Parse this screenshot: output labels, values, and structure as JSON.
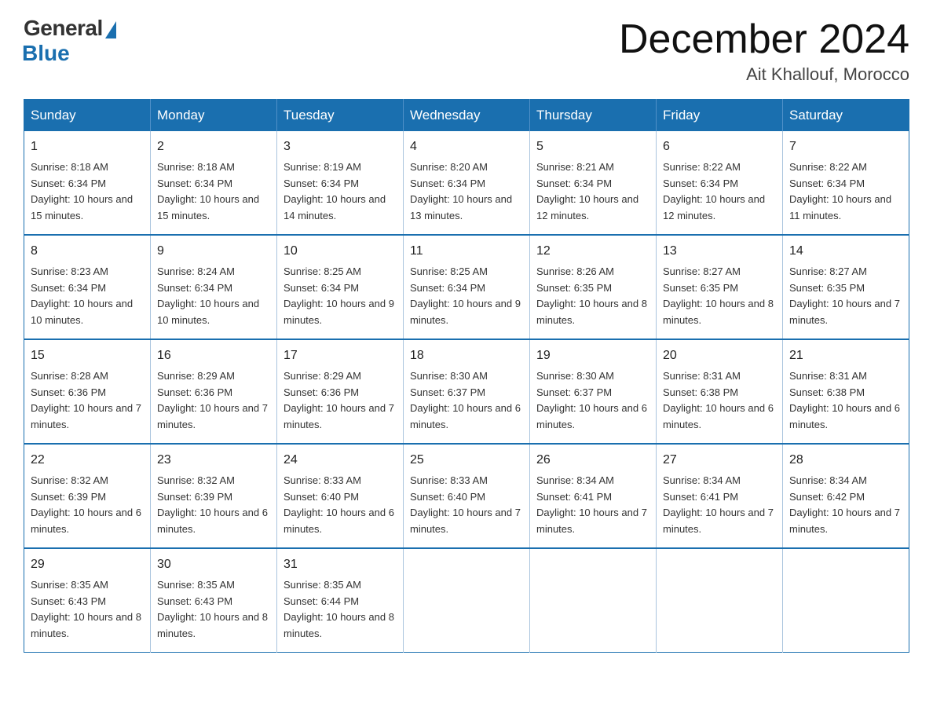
{
  "header": {
    "logo_general": "General",
    "logo_blue": "Blue",
    "title": "December 2024",
    "subtitle": "Ait Khallouf, Morocco"
  },
  "weekdays": [
    "Sunday",
    "Monday",
    "Tuesday",
    "Wednesday",
    "Thursday",
    "Friday",
    "Saturday"
  ],
  "weeks": [
    [
      {
        "day": "1",
        "sunrise": "8:18 AM",
        "sunset": "6:34 PM",
        "daylight": "10 hours and 15 minutes."
      },
      {
        "day": "2",
        "sunrise": "8:18 AM",
        "sunset": "6:34 PM",
        "daylight": "10 hours and 15 minutes."
      },
      {
        "day": "3",
        "sunrise": "8:19 AM",
        "sunset": "6:34 PM",
        "daylight": "10 hours and 14 minutes."
      },
      {
        "day": "4",
        "sunrise": "8:20 AM",
        "sunset": "6:34 PM",
        "daylight": "10 hours and 13 minutes."
      },
      {
        "day": "5",
        "sunrise": "8:21 AM",
        "sunset": "6:34 PM",
        "daylight": "10 hours and 12 minutes."
      },
      {
        "day": "6",
        "sunrise": "8:22 AM",
        "sunset": "6:34 PM",
        "daylight": "10 hours and 12 minutes."
      },
      {
        "day": "7",
        "sunrise": "8:22 AM",
        "sunset": "6:34 PM",
        "daylight": "10 hours and 11 minutes."
      }
    ],
    [
      {
        "day": "8",
        "sunrise": "8:23 AM",
        "sunset": "6:34 PM",
        "daylight": "10 hours and 10 minutes."
      },
      {
        "day": "9",
        "sunrise": "8:24 AM",
        "sunset": "6:34 PM",
        "daylight": "10 hours and 10 minutes."
      },
      {
        "day": "10",
        "sunrise": "8:25 AM",
        "sunset": "6:34 PM",
        "daylight": "10 hours and 9 minutes."
      },
      {
        "day": "11",
        "sunrise": "8:25 AM",
        "sunset": "6:34 PM",
        "daylight": "10 hours and 9 minutes."
      },
      {
        "day": "12",
        "sunrise": "8:26 AM",
        "sunset": "6:35 PM",
        "daylight": "10 hours and 8 minutes."
      },
      {
        "day": "13",
        "sunrise": "8:27 AM",
        "sunset": "6:35 PM",
        "daylight": "10 hours and 8 minutes."
      },
      {
        "day": "14",
        "sunrise": "8:27 AM",
        "sunset": "6:35 PM",
        "daylight": "10 hours and 7 minutes."
      }
    ],
    [
      {
        "day": "15",
        "sunrise": "8:28 AM",
        "sunset": "6:36 PM",
        "daylight": "10 hours and 7 minutes."
      },
      {
        "day": "16",
        "sunrise": "8:29 AM",
        "sunset": "6:36 PM",
        "daylight": "10 hours and 7 minutes."
      },
      {
        "day": "17",
        "sunrise": "8:29 AM",
        "sunset": "6:36 PM",
        "daylight": "10 hours and 7 minutes."
      },
      {
        "day": "18",
        "sunrise": "8:30 AM",
        "sunset": "6:37 PM",
        "daylight": "10 hours and 6 minutes."
      },
      {
        "day": "19",
        "sunrise": "8:30 AM",
        "sunset": "6:37 PM",
        "daylight": "10 hours and 6 minutes."
      },
      {
        "day": "20",
        "sunrise": "8:31 AM",
        "sunset": "6:38 PM",
        "daylight": "10 hours and 6 minutes."
      },
      {
        "day": "21",
        "sunrise": "8:31 AM",
        "sunset": "6:38 PM",
        "daylight": "10 hours and 6 minutes."
      }
    ],
    [
      {
        "day": "22",
        "sunrise": "8:32 AM",
        "sunset": "6:39 PM",
        "daylight": "10 hours and 6 minutes."
      },
      {
        "day": "23",
        "sunrise": "8:32 AM",
        "sunset": "6:39 PM",
        "daylight": "10 hours and 6 minutes."
      },
      {
        "day": "24",
        "sunrise": "8:33 AM",
        "sunset": "6:40 PM",
        "daylight": "10 hours and 6 minutes."
      },
      {
        "day": "25",
        "sunrise": "8:33 AM",
        "sunset": "6:40 PM",
        "daylight": "10 hours and 7 minutes."
      },
      {
        "day": "26",
        "sunrise": "8:34 AM",
        "sunset": "6:41 PM",
        "daylight": "10 hours and 7 minutes."
      },
      {
        "day": "27",
        "sunrise": "8:34 AM",
        "sunset": "6:41 PM",
        "daylight": "10 hours and 7 minutes."
      },
      {
        "day": "28",
        "sunrise": "8:34 AM",
        "sunset": "6:42 PM",
        "daylight": "10 hours and 7 minutes."
      }
    ],
    [
      {
        "day": "29",
        "sunrise": "8:35 AM",
        "sunset": "6:43 PM",
        "daylight": "10 hours and 8 minutes."
      },
      {
        "day": "30",
        "sunrise": "8:35 AM",
        "sunset": "6:43 PM",
        "daylight": "10 hours and 8 minutes."
      },
      {
        "day": "31",
        "sunrise": "8:35 AM",
        "sunset": "6:44 PM",
        "daylight": "10 hours and 8 minutes."
      },
      null,
      null,
      null,
      null
    ]
  ]
}
